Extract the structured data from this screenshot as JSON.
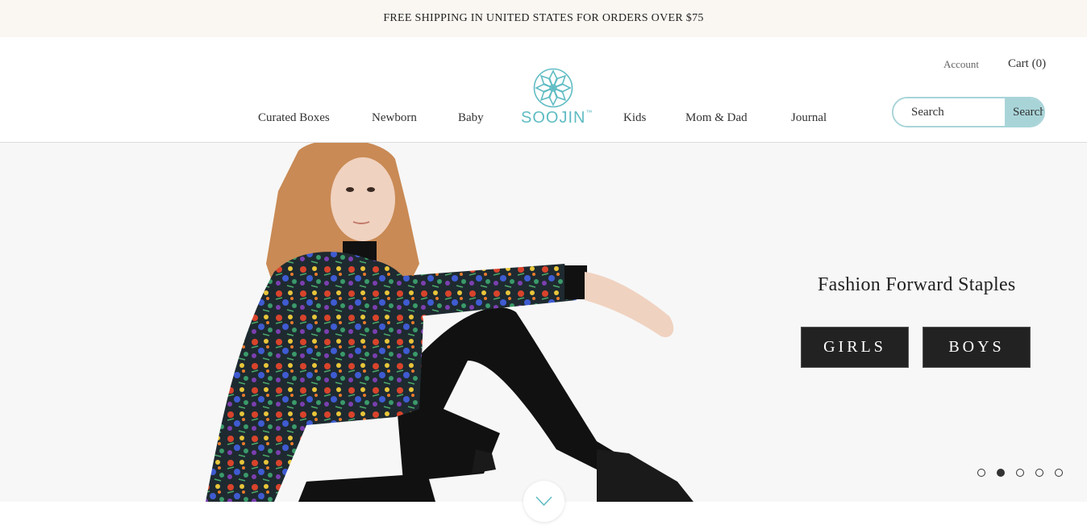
{
  "announcement": "FREE SHIPPING IN UNITED STATES FOR ORDERS OVER $75",
  "header": {
    "account": "Account",
    "cart": "Cart (0)",
    "logo_text": "SOOJIN",
    "logo_mark": "™",
    "nav": [
      "Curated Boxes",
      "Newborn",
      "Baby",
      "Kids",
      "Mom & Dad",
      "Journal"
    ],
    "search": {
      "placeholder": "Search",
      "button": "Search"
    }
  },
  "hero": {
    "heading": "Fashion Forward Staples",
    "buttons": [
      "GIRLS",
      "BOYS"
    ],
    "slides": 5,
    "active_slide": 2,
    "scroll_icon": "chevron-down-icon"
  },
  "colors": {
    "brand_teal": "#5fbcc3",
    "search_accent": "#a8d4d8",
    "announcement_bg": "#faf7f2",
    "button_bg": "#222222"
  }
}
